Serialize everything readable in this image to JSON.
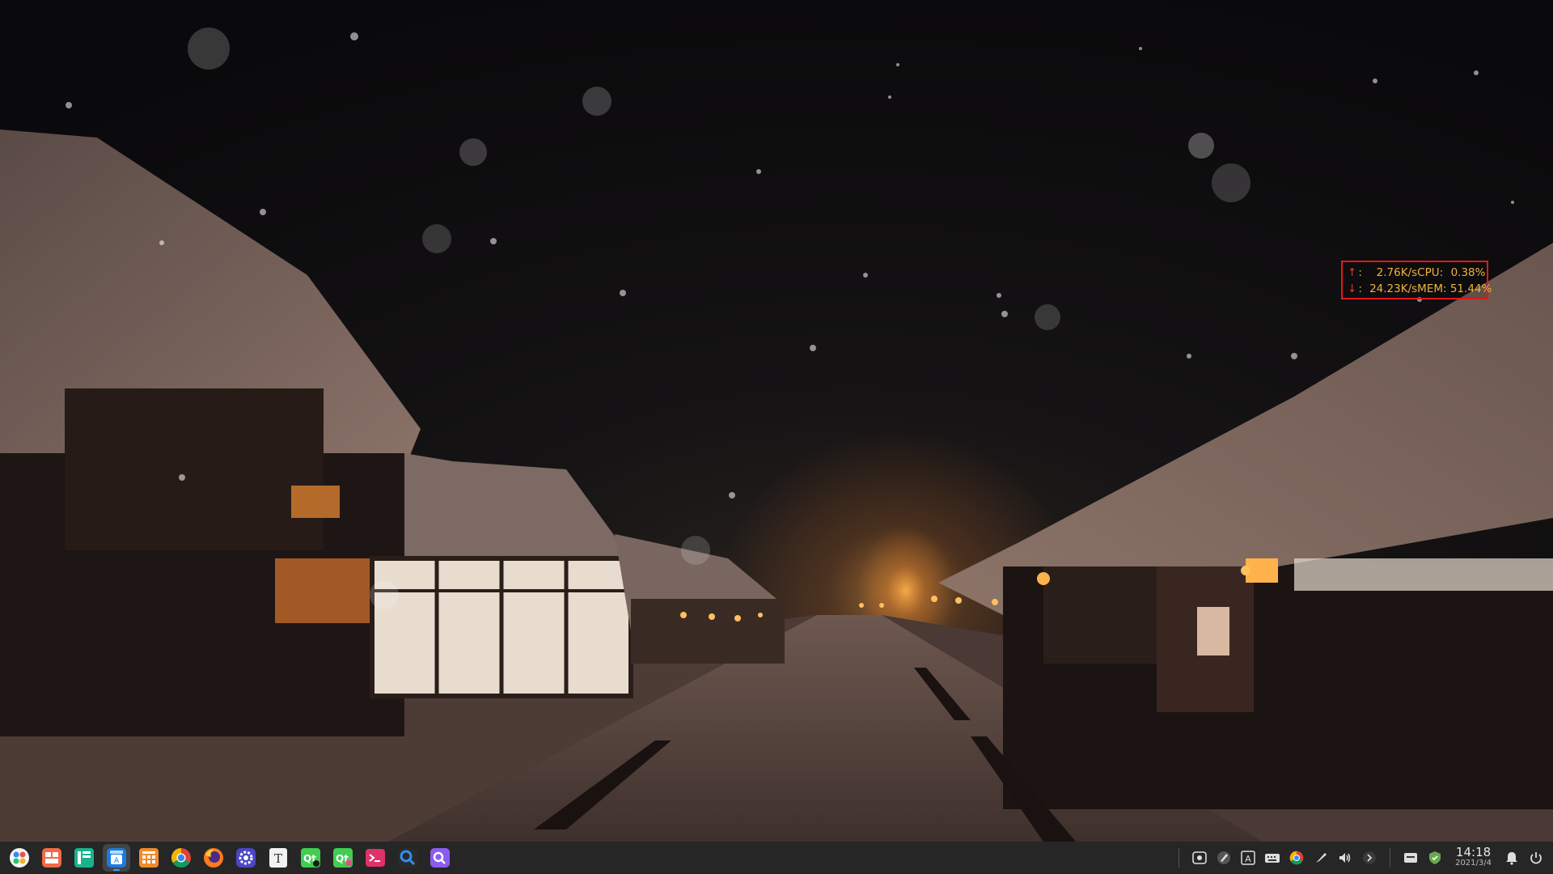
{
  "netmon": {
    "upload_arrow": "↑",
    "upload_label": ":",
    "upload_speed": "2.76K/s",
    "download_arrow": "↓",
    "download_label": ":",
    "download_speed": "24.23K/s",
    "cpu_label": "CPU:",
    "cpu_value": "0.38%",
    "mem_label": "MEM:",
    "mem_value": "51.44%"
  },
  "taskbar": {
    "apps": [
      {
        "name": "launcher",
        "icon": "launcher-icon",
        "color": "#ffffff"
      },
      {
        "name": "multitasking",
        "icon": "multitask-view-icon",
        "color": "#f06a4a"
      },
      {
        "name": "show-desktop",
        "icon": "desktop-icon",
        "color": "#18b38e"
      },
      {
        "name": "app-store",
        "icon": "store-icon",
        "color": "#1c7be0"
      },
      {
        "name": "files",
        "icon": "grid-icon",
        "color": "#f08a2a"
      },
      {
        "name": "chrome",
        "icon": "chrome-icon",
        "color": "#ffffff"
      },
      {
        "name": "firefox",
        "icon": "firefox-icon",
        "color": "#ff6a1a"
      },
      {
        "name": "settings",
        "icon": "gear-icon",
        "color": "#4a46c8"
      },
      {
        "name": "text-editor",
        "icon": "text-editor-icon",
        "color": "#f2f2f2"
      },
      {
        "name": "qt-creator",
        "icon": "qt-icon",
        "color": "#41cd52"
      },
      {
        "name": "qt-designer",
        "icon": "qt-designer-icon",
        "color": "#41cd52"
      },
      {
        "name": "terminal",
        "icon": "terminal-icon",
        "color": "#e0326a"
      },
      {
        "name": "search",
        "icon": "search-icon",
        "color": "#1a6fd0"
      },
      {
        "name": "music",
        "icon": "music-icon",
        "color": "#8a5cf0"
      }
    ],
    "tray_icons": [
      "screenshot-icon",
      "pen-icon",
      "input-method-icon",
      "keyboard-icon",
      "chrome-tray-icon",
      "brush-icon",
      "volume-icon",
      "expand-tray-icon",
      "message-icon",
      "shield-icon"
    ],
    "clock": {
      "time": "14:18",
      "date": "2021/3/4"
    },
    "notification_icon": "bell-icon",
    "power_icon": "power-icon"
  }
}
